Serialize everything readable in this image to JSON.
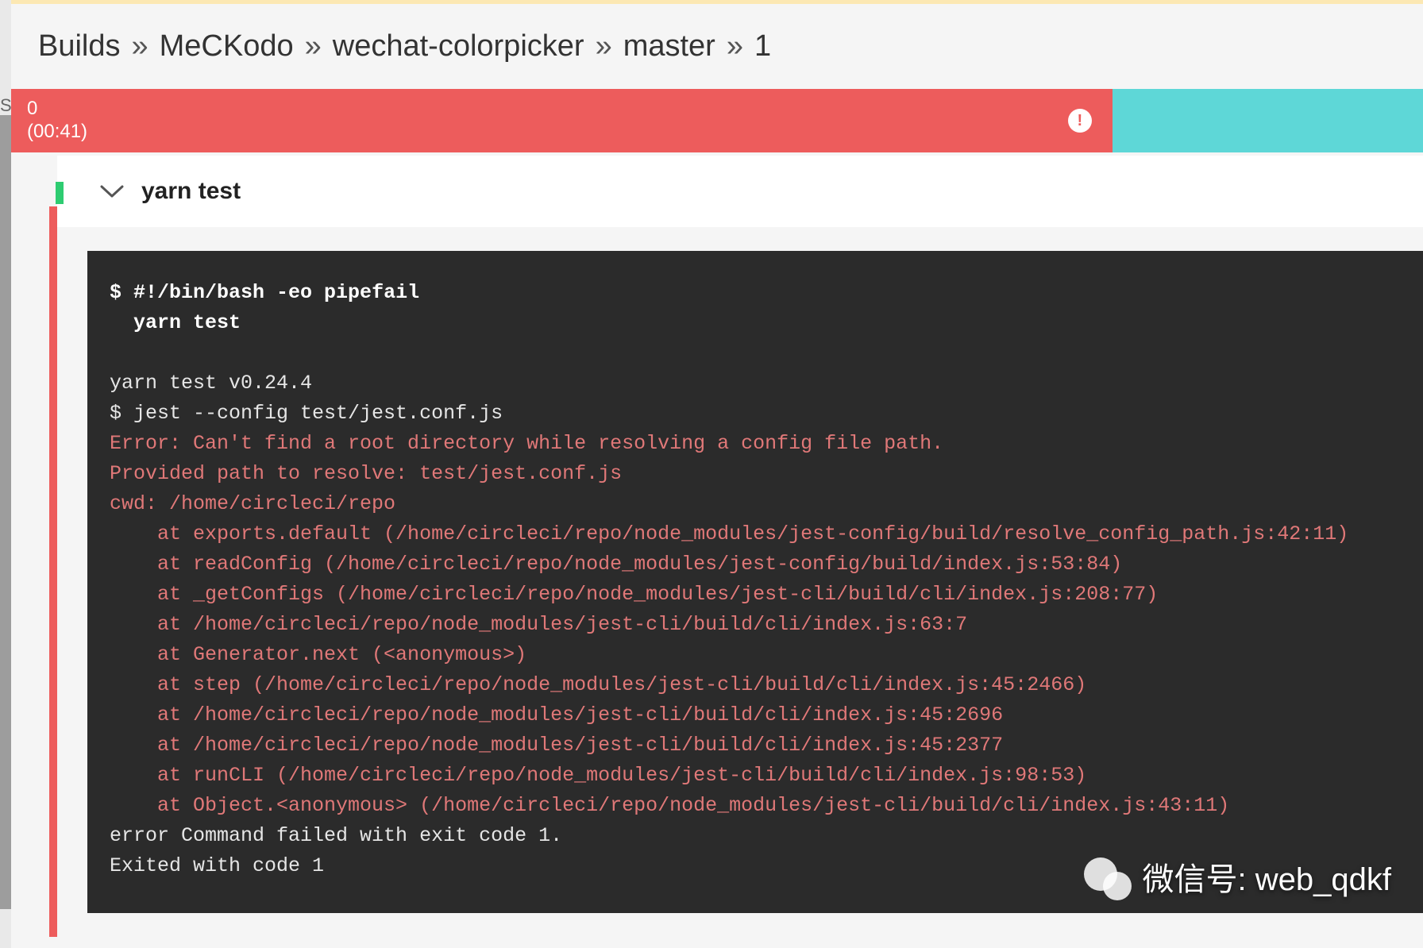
{
  "breadcrumb": {
    "items": [
      "Builds",
      "MeCKodo",
      "wechat-colorpicker",
      "master",
      "1"
    ],
    "separator": "»"
  },
  "sidebar_char": "S",
  "step": {
    "index": "0",
    "duration": "(00:41)"
  },
  "section": {
    "title": "yarn test"
  },
  "terminal": {
    "cmd_prefix": "$ ",
    "shebang": "#!/bin/bash -eo pipefail",
    "cmd_indent": "  yarn test",
    "lines_plain_1": "yarn test v0.24.4",
    "lines_plain_2": "$ jest --config test/jest.conf.js",
    "err_1": "Error: Can't find a root directory while resolving a config file path.",
    "err_2": "Provided path to resolve: test/jest.conf.js",
    "err_3": "cwd: /home/circleci/repo",
    "err_4": "    at exports.default (/home/circleci/repo/node_modules/jest-config/build/resolve_config_path.js:42:11)",
    "err_5": "    at readConfig (/home/circleci/repo/node_modules/jest-config/build/index.js:53:84)",
    "err_6": "    at _getConfigs (/home/circleci/repo/node_modules/jest-cli/build/cli/index.js:208:77)",
    "err_7": "    at /home/circleci/repo/node_modules/jest-cli/build/cli/index.js:63:7",
    "err_8": "    at Generator.next (<anonymous>)",
    "err_9": "    at step (/home/circleci/repo/node_modules/jest-cli/build/cli/index.js:45:2466)",
    "err_10": "    at /home/circleci/repo/node_modules/jest-cli/build/cli/index.js:45:2696",
    "err_11": "    at /home/circleci/repo/node_modules/jest-cli/build/cli/index.js:45:2377",
    "err_12": "    at runCLI (/home/circleci/repo/node_modules/jest-cli/build/cli/index.js:98:53)",
    "err_13": "    at Object.<anonymous> (/home/circleci/repo/node_modules/jest-cli/build/cli/index.js:43:11)",
    "tail_1": "error Command failed with exit code 1.",
    "tail_2": "Exited with code 1"
  },
  "watermark": {
    "text": "微信号: web_qdkf"
  }
}
